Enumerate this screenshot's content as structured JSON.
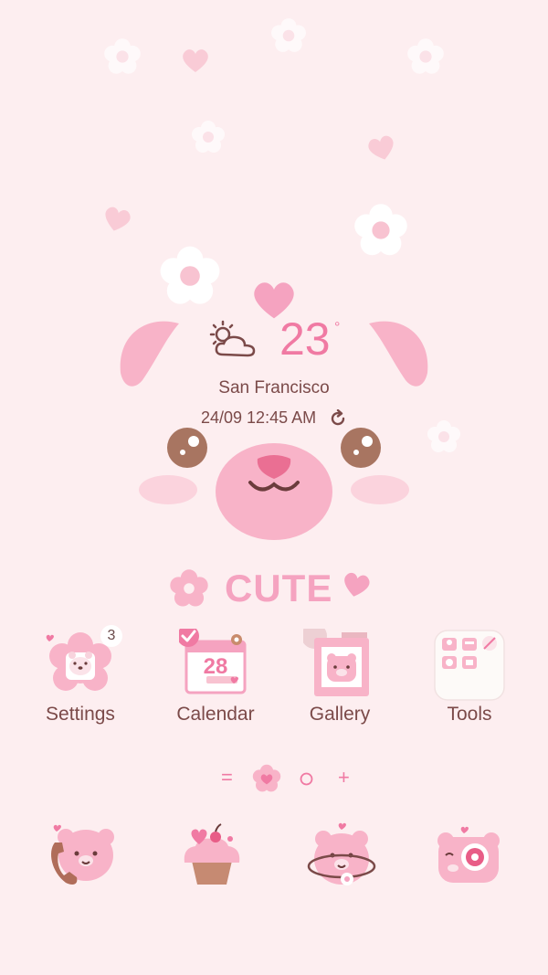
{
  "theme": {
    "accent": "#f07aa3",
    "background": "#fdeef0",
    "text": "#7b4a49",
    "bear_pink": "#f8b3c8"
  },
  "weather": {
    "icon": "partly-cloudy-icon",
    "temperature": "23",
    "unit": "°",
    "city": "San Francisco",
    "datetime": "24/09 12:45 AM",
    "refresh_icon": "refresh-icon"
  },
  "banner": {
    "text": "CUTE"
  },
  "apps": [
    {
      "label": "Settings",
      "icon": "settings-bear-icon",
      "badge": "3"
    },
    {
      "label": "Calendar",
      "icon": "calendar-icon",
      "date": "28"
    },
    {
      "label": "Gallery",
      "icon": "gallery-icon"
    },
    {
      "label": "Tools",
      "icon": "tools-folder-icon"
    }
  ],
  "pager": {
    "menu": "=",
    "add": "+"
  },
  "dock": [
    {
      "icon": "phone-bear-icon"
    },
    {
      "icon": "cupcake-icon"
    },
    {
      "icon": "browser-bear-icon"
    },
    {
      "icon": "camera-bear-icon"
    }
  ]
}
